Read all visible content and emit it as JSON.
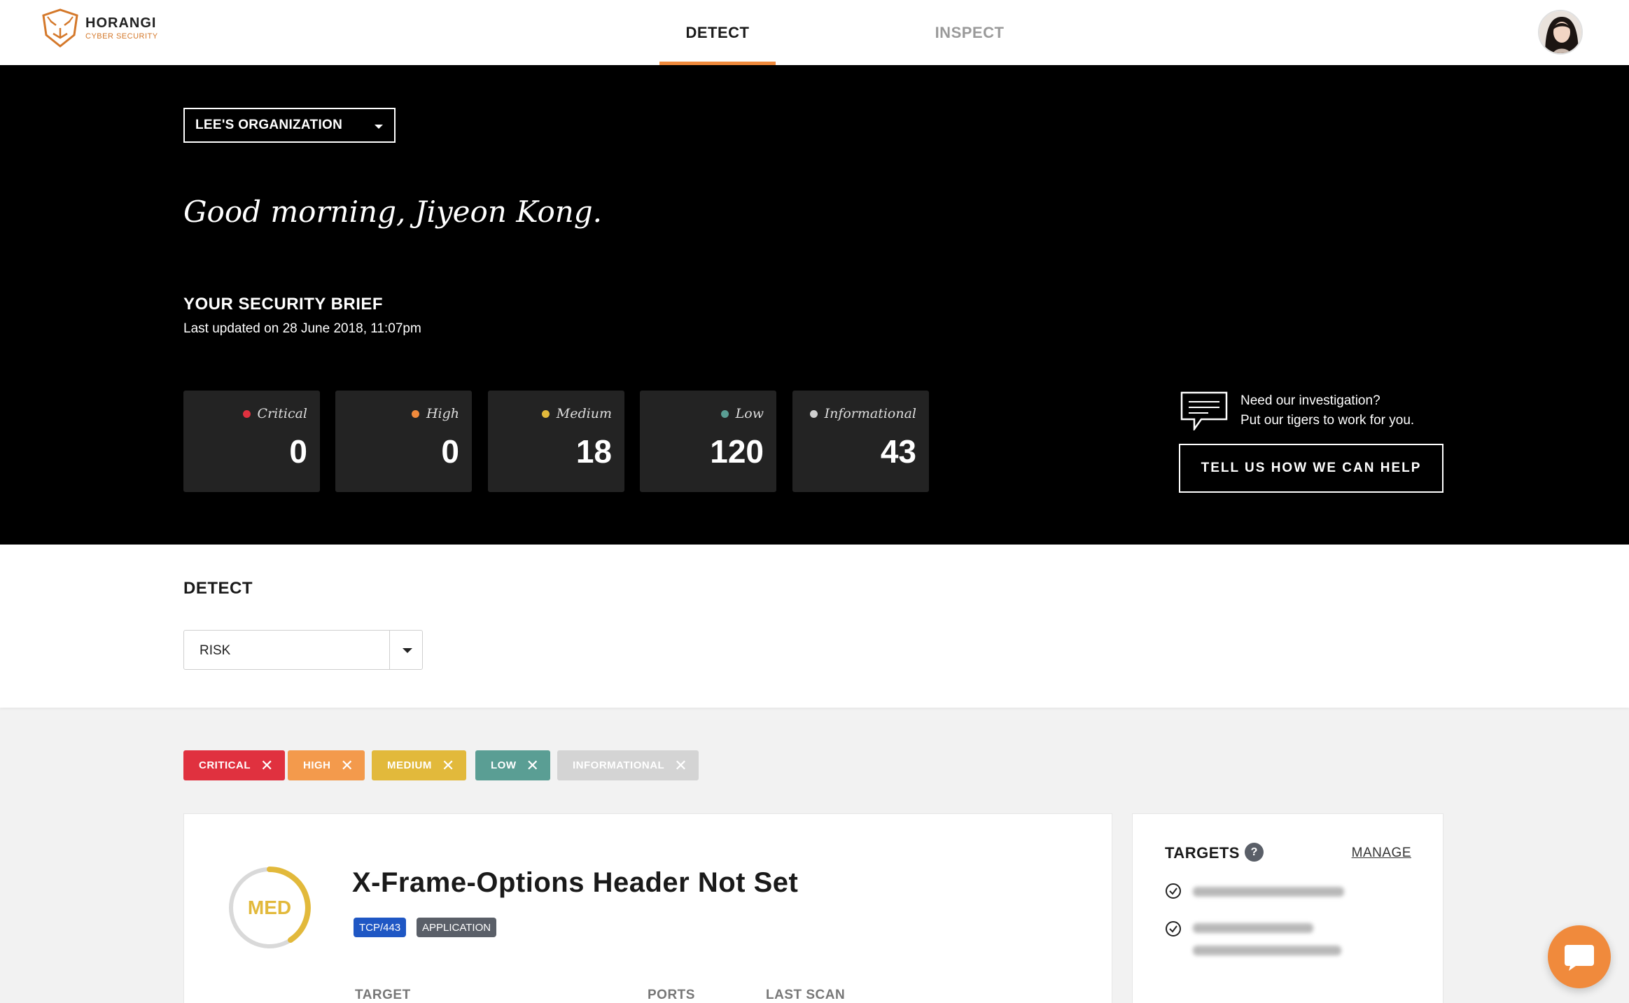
{
  "brand": {
    "name": "HORANGI",
    "subtitle": "CYBER SECURITY"
  },
  "nav": {
    "tabs": [
      {
        "label": "DETECT",
        "active": true
      },
      {
        "label": "INSPECT",
        "active": false
      }
    ]
  },
  "hero": {
    "org_select": "LEE'S ORGANIZATION",
    "greeting": "Good morning, Jiyeon Kong.",
    "brief_title": "YOUR SECURITY BRIEF",
    "brief_updated": "Last updated on 28 June 2018, 11:07pm",
    "stats": [
      {
        "label": "Critical",
        "value": "0",
        "color": "#e0313f"
      },
      {
        "label": "High",
        "value": "0",
        "color": "#f08a3c"
      },
      {
        "label": "Medium",
        "value": "18",
        "color": "#e2b93b"
      },
      {
        "label": "Low",
        "value": "120",
        "color": "#5a9e94"
      },
      {
        "label": "Informational",
        "value": "43",
        "color": "#cfcfcf"
      }
    ],
    "help_line1": "Need our investigation?",
    "help_line2": "Put our tigers to work for you.",
    "help_button": "TELL US HOW WE CAN HELP"
  },
  "detect": {
    "title": "DETECT",
    "risk_select": "RISK",
    "filters": [
      {
        "label": "CRITICAL",
        "color": "#e0313f"
      },
      {
        "label": "HIGH",
        "color": "#f39a4c"
      },
      {
        "label": "MEDIUM",
        "color": "#e2b93b"
      },
      {
        "label": "LOW",
        "color": "#5a9e94"
      },
      {
        "label": "INFORMATIONAL",
        "color": "#d4d4d4"
      }
    ]
  },
  "finding": {
    "severity_label": "MED",
    "severity_color": "#e2b93b",
    "title": "X-Frame-Options Header Not Set",
    "tags": [
      {
        "label": "TCP/443",
        "color": "#1f57c4"
      },
      {
        "label": "APPLICATION",
        "color": "#5a5f68"
      }
    ],
    "columns": [
      "TARGET",
      "PORTS",
      "LAST SCAN"
    ]
  },
  "targets": {
    "title": "TARGETS",
    "help": "?",
    "manage": "MANAGE"
  },
  "colors": {
    "accent": "#f08a3c",
    "hero_bg": "#000000",
    "card_bg": "#232323"
  }
}
